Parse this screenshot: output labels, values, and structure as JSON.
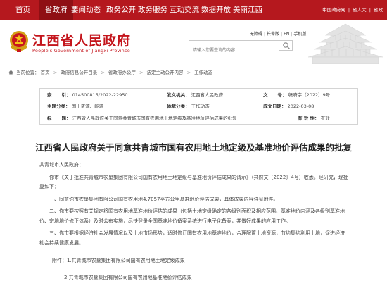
{
  "nav": {
    "items": [
      "首页",
      "省政府",
      "要闻动态",
      "政务公开",
      "政务服务",
      "互动交流",
      "数据开放",
      "美丽江西"
    ],
    "active_index": 1,
    "top_links": [
      "中国政府网",
      "省人大",
      "省政"
    ]
  },
  "header": {
    "title": "江西省人民政府",
    "subtitle": "People's Government of Jiangxi Province",
    "util_links": [
      "无障碍",
      "长辈版",
      "EN",
      "手机版"
    ],
    "search_placeholder": "请输入您要查询的内容",
    "emblem_icon": "national-emblem-icon",
    "pavilion_icon": "tengwang-pavilion-icon"
  },
  "breadcrumb": {
    "label": "当前位置：",
    "items": [
      "首页",
      "政府信息公开目录",
      "省政府办公厅",
      "法定主动公开内容",
      "工作动态"
    ]
  },
  "meta": {
    "index_key": "索",
    "index_key2": "引",
    "index_val": "014500815/2022-22950",
    "issuer_key": "发文机关：",
    "issuer_val": "江西省人民政府",
    "docno_key": "文",
    "docno_key2": "号：",
    "docno_val": "赣府字〔2022〕9号",
    "topic_key": "主题分类：",
    "topic_val": "国土资源、能源",
    "type_key": "体裁分类：",
    "type_val": "工作动态",
    "date_key": "成文日期：",
    "date_val": "2022-03-08",
    "title_key": "标",
    "title_key2": "题：",
    "title_val": "江西省人民政府关于同意共青城市国有农用地土地定级及基准地价评估成果的批复",
    "valid_key": "有 效 性：",
    "valid_val": "有效"
  },
  "document": {
    "title": "江西省人民政府关于同意共青城市国有农用地土地定级及基准地价评估成果的批复",
    "salutation": "共青城市人民政府：",
    "para1": "你市《关于批准共青城市农垦集团有限公司国有农用地土地定级与基准地价评估成果的请示》（共府文〔2022〕4号）收悉。经研究，现批复如下：",
    "para2": "一、同意你市农垦集团有限公司国有农用地4.7057平方公里基准地价评估成果，具体成果内容详见附件。",
    "para3": "二、你市要按照有关规定将国有农用地基准地价评估的成果（包括土地定级确定的各级别面积及相应范围、基准地价内涵及各级别基准地价、宗地地价修正体系）及时公布实施，尽快登录全国基准地价备案系统进行电子化备案，并做好成果的应用工作。",
    "para4": "三、你市要根据经济社会发展情况以及土地市场形势，适时修订国有农用地基准地价，合理配置土地资源，节约集约利用土地，促进经济社会持续健康发展。",
    "attach1": "附件：1.共青城市农垦集团有限公司国有农用地土地定级成果",
    "attach2": "2.共青城市农垦集团有限公司国有农用地基准地价评估成果"
  }
}
